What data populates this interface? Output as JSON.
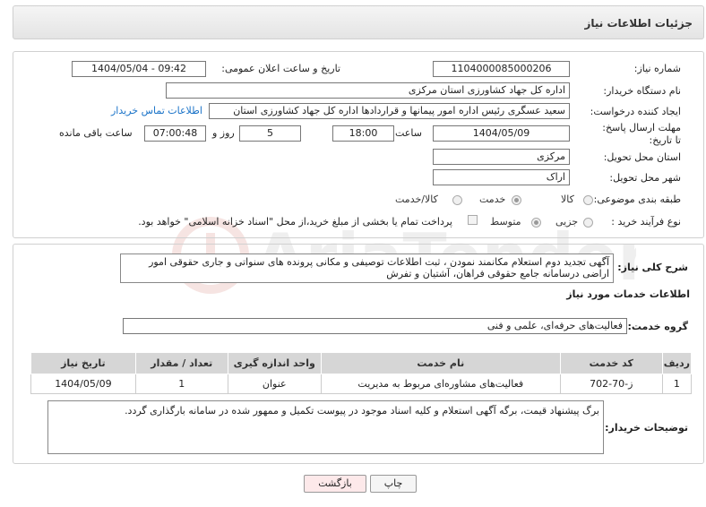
{
  "header": {
    "title": "جزئیات اطلاعات نیاز"
  },
  "form": {
    "need_number": {
      "label": "شماره نیاز:",
      "value": "1104000085000206"
    },
    "announce_datetime": {
      "label": "تاریخ و ساعت اعلان عمومی:",
      "value": "1404/05/04 - 09:42"
    },
    "buyer_org": {
      "label": "نام دستگاه خریدار:",
      "value": "اداره کل جهاد کشاورزی استان مرکزی"
    },
    "creator": {
      "label": "ایجاد کننده درخواست:",
      "value": "سعید عسگری رئیس اداره امور پیمانها و قراردادها اداره کل جهاد کشاورزی استان",
      "contact_link": "اطلاعات تماس خریدار"
    },
    "deadline": {
      "label": "مهلت ارسال پاسخ: تا تاریخ:",
      "date": "1404/05/09",
      "time_label": "ساعت",
      "time": "18:00",
      "days": "5",
      "days_label": "روز و",
      "remaining": "07:00:48",
      "remaining_label": "ساعت باقی مانده"
    },
    "delivery_province": {
      "label": "استان محل تحویل:",
      "value": "مرکزی"
    },
    "delivery_city": {
      "label": "شهر محل تحویل:",
      "value": "اراک"
    },
    "category": {
      "label": "طبقه بندی موضوعی:",
      "options": [
        "کالا",
        "خدمت",
        "کالا/خدمت"
      ],
      "selected": "خدمت"
    },
    "process": {
      "label": "نوع فرآیند خرید :",
      "options": [
        "جزیی",
        "متوسط"
      ],
      "selected": "متوسط",
      "note": "پرداخت تمام یا بخشی از مبلغ خرید،از محل \"اسناد خزانه اسلامی\" خواهد بود."
    }
  },
  "description": {
    "label": "شرح کلی نیاز:",
    "value": "آگهی تجدید دوم استعلام  مکانمند نمودن ، ثبت اطلاعات توصیفی و مکانی پرونده های سنواتی و جاری حقوقی امور اراضی درسامانه جامع حقوقی فراهان، آشتیان و تفرش"
  },
  "services": {
    "section_title": "اطلاعات خدمات مورد نیاز",
    "group_label": "گروه خدمت:",
    "group_value": "فعالیت‌های حرفه‌ای، علمی و فنی",
    "columns": [
      "ردیف",
      "کد خدمت",
      "نام خدمت",
      "واحد اندازه گیری",
      "تعداد / مقدار",
      "تاریخ نیاز"
    ],
    "rows": [
      {
        "row": "1",
        "code": "ز-70-702",
        "name": "فعالیت‌های مشاوره‌ای مربوط به مدیریت",
        "unit": "عنوان",
        "qty": "1",
        "date": "1404/05/09"
      }
    ]
  },
  "buyer_notes": {
    "label": "توضیحات خریدار:",
    "value": "برگ پیشنهاد قیمت، برگه آگهی استعلام و  کلیه اسناد موجود در پیوست تکمیل و ممهور  شده در سامانه بارگذاری گردد."
  },
  "buttons": {
    "print": "چاپ",
    "back": "بازگشت"
  },
  "colors": {
    "link": "#1a73c8",
    "back_button": "#fde9ea",
    "table_header": "#d6d6d6"
  }
}
